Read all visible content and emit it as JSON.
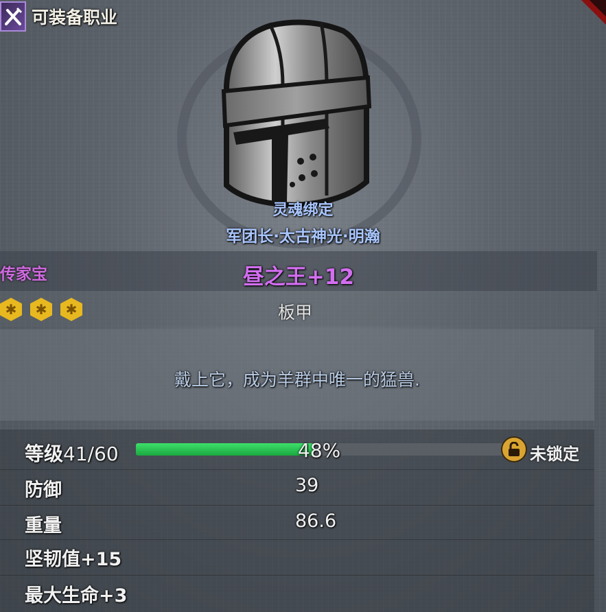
{
  "header": {
    "class_label": "可装备职业",
    "class_icon": "crossed-tools-icon"
  },
  "item": {
    "binding": "灵魂绑定",
    "owner": "军团长·太古神光·明瀚",
    "rarity": "传家宝",
    "name": "昼之王+12",
    "type": "板甲",
    "description": "戴上它，成为羊群中唯一的猛兽.",
    "gems": [
      "gem-icon",
      "gem-icon",
      "gem-icon"
    ]
  },
  "level": {
    "label": "等级",
    "value": "41/60",
    "progress_text": "48%",
    "progress_fraction": 0.48,
    "lock_label": "未锁定",
    "lock_icon": "padlock-open-icon"
  },
  "stats": [
    {
      "label": "防御",
      "value": "39"
    },
    {
      "label": "重量",
      "value": "86.6"
    }
  ],
  "bonuses": [
    {
      "label": "坚韧值+15"
    },
    {
      "label": "最大生命+3"
    }
  ],
  "colors": {
    "rarity": "#d06ae0",
    "binding": "#a9c6ff",
    "xp_fill": "#2bc455",
    "lock": "#d9a431"
  }
}
